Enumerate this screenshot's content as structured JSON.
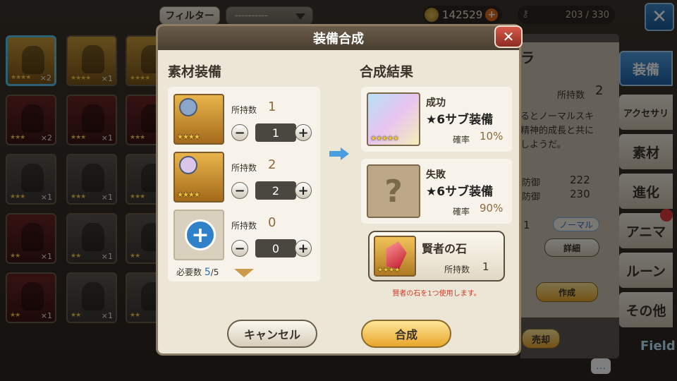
{
  "topbar": {
    "filter_label": "フィルター",
    "filter_value": "----------",
    "gold": "142529",
    "capacity": "203 / 330"
  },
  "inventory": [
    {
      "stars": "★★★★",
      "count": "×2"
    },
    {
      "stars": "★★★★",
      "count": "×1"
    },
    {
      "stars": "★★★★",
      "count": ""
    },
    {
      "stars": "★★★",
      "count": "×2"
    },
    {
      "stars": "★★★",
      "count": "×1"
    },
    {
      "stars": "★★★",
      "count": ""
    },
    {
      "stars": "★★★",
      "count": "×1"
    },
    {
      "stars": "★★★",
      "count": "×1"
    },
    {
      "stars": "★★★",
      "count": ""
    },
    {
      "stars": "★★",
      "count": "×1"
    },
    {
      "stars": "★★",
      "count": "×1"
    },
    {
      "stars": "★★",
      "count": ""
    },
    {
      "stars": "★★",
      "count": "×1"
    },
    {
      "stars": "★★",
      "count": "×1"
    },
    {
      "stars": "★★",
      "count": ""
    }
  ],
  "tabs": [
    "装備",
    "アクセサリ",
    "素材",
    "進化",
    "アニマ",
    "ルーン",
    "その他"
  ],
  "detail": {
    "title_frag": "ラ",
    "hold_label": "所持数",
    "hold_value": "2",
    "desc": "るとノーマルスキ\n精神的成長と共に\nしようだ。",
    "def1_label": "防御",
    "def1_value": "222",
    "def2_label": "防御",
    "def2_value": "230",
    "count_frag": "1",
    "rarity": "ノーマル",
    "detail_btn": "詳細",
    "create_btn": "作成",
    "sell_btn": "売却"
  },
  "modal": {
    "title": "装備合成",
    "materials_title": "素材装備",
    "results_title": "合成結果",
    "materials": [
      {
        "stars": "★★★★",
        "hold_label": "所持数",
        "hold": "1",
        "qty": "1"
      },
      {
        "stars": "★★★★",
        "hold_label": "所持数",
        "hold": "2",
        "qty": "2"
      },
      {
        "stars": "",
        "hold_label": "所持数",
        "hold": "0",
        "qty": "0"
      }
    ],
    "need_label": "必要数",
    "need_current": "5",
    "need_total": "/5",
    "success": {
      "kind": "成功",
      "name": "★6サブ装備",
      "rate_label": "確率",
      "rate": "10%",
      "stars": "★★★★★"
    },
    "failure": {
      "kind": "失敗",
      "name": "★6サブ装備",
      "rate_label": "確率",
      "rate": "90%",
      "icon": "?"
    },
    "stone": {
      "name": "賢者の石",
      "hold_label": "所持数",
      "hold": "1",
      "stars": "★★★★"
    },
    "stone_note": "賢者の石を1つ使用します。",
    "cancel": "キャンセル",
    "ok": "合成"
  },
  "field_label": "Field"
}
